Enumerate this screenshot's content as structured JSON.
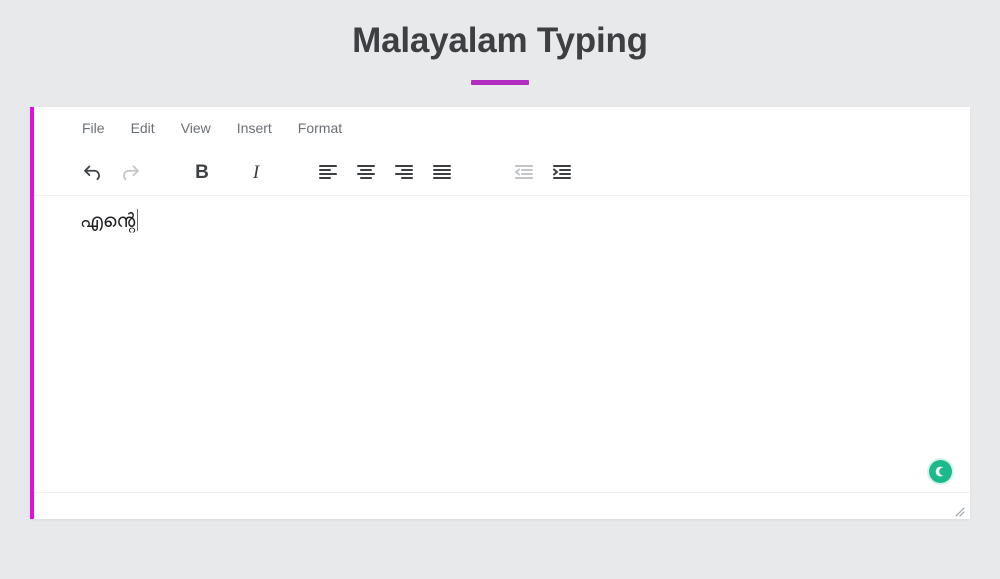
{
  "page": {
    "title": "Malayalam Typing",
    "accent_color": "#b32cc0",
    "background_color": "#e8e9eb"
  },
  "editor": {
    "accent_bar_color": "#e010e0",
    "menu": [
      {
        "label": "File",
        "name": "menu-file"
      },
      {
        "label": "Edit",
        "name": "menu-edit"
      },
      {
        "label": "View",
        "name": "menu-view"
      },
      {
        "label": "Insert",
        "name": "menu-insert"
      },
      {
        "label": "Format",
        "name": "menu-format"
      }
    ],
    "toolbar": [
      {
        "icon": "undo-icon",
        "label": "Undo",
        "state": "enabled"
      },
      {
        "icon": "redo-icon",
        "label": "Redo",
        "state": "disabled"
      },
      {
        "icon": "bold-icon",
        "label": "B",
        "state": "enabled"
      },
      {
        "icon": "italic-icon",
        "label": "I",
        "state": "enabled"
      },
      {
        "icon": "align-left-icon",
        "label": "Align left",
        "state": "enabled"
      },
      {
        "icon": "align-center-icon",
        "label": "Align center",
        "state": "enabled"
      },
      {
        "icon": "align-right-icon",
        "label": "Align right",
        "state": "enabled"
      },
      {
        "icon": "align-justify-icon",
        "label": "Justify",
        "state": "enabled"
      },
      {
        "icon": "decrease-indent-icon",
        "label": "Decrease indent",
        "state": "disabled"
      },
      {
        "icon": "increase-indent-icon",
        "label": "Increase indent",
        "state": "enabled"
      }
    ],
    "document": {
      "text": "എന്റെ",
      "caret_visible": true
    },
    "grammar_badge": {
      "name": "grammar-check-badge",
      "color": "#1cb98c",
      "glyph": "crescent-icon"
    },
    "resize_handle": {
      "name": "resize-grip-icon"
    }
  }
}
